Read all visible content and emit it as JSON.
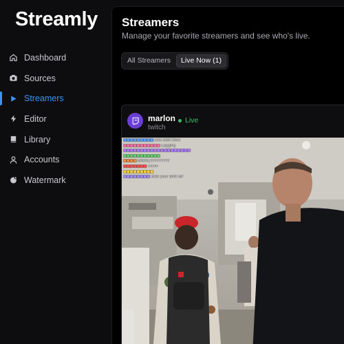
{
  "app": {
    "title": "Streamly"
  },
  "sidebar": {
    "items": [
      {
        "label": "Dashboard",
        "icon": "home-icon",
        "active": false
      },
      {
        "label": "Sources",
        "icon": "camera-icon",
        "active": false
      },
      {
        "label": "Streamers",
        "icon": "play-icon",
        "active": true
      },
      {
        "label": "Editor",
        "icon": "bolt-icon",
        "active": false
      },
      {
        "label": "Library",
        "icon": "book-icon",
        "active": false
      },
      {
        "label": "Accounts",
        "icon": "user-icon",
        "active": false
      },
      {
        "label": "Watermark",
        "icon": "watermark-icon",
        "active": false
      }
    ]
  },
  "page": {
    "title": "Streamers",
    "subtitle": "Manage your favorite streamers and see who's live."
  },
  "filters": {
    "all_label": "All Streamers",
    "live_label": "Live Now (1)",
    "selected": "Live Now (1)"
  },
  "stream_card": {
    "name": "marlon",
    "platform": "twitch",
    "status": "Live",
    "chat": [
      {
        "user": "",
        "message": "new shirt time",
        "color": "#5aa0ff"
      },
      {
        "user": "",
        "message": "Lagging",
        "color": "#ff6fa8"
      },
      {
        "user": "",
        "message": "",
        "color": "#b07cff"
      },
      {
        "user": "",
        "message": "",
        "color": "#62d36c"
      },
      {
        "user": "",
        "message": "BRRRZYYYYYYYYY",
        "color": "#ff8a3d"
      },
      {
        "user": "",
        "message": "FFFFF",
        "color": "#ff4d4d"
      },
      {
        "user": "",
        "message": "",
        "color": "#ffd23d"
      },
      {
        "user": "",
        "message": "take your shirt off",
        "color": "#9f8cff"
      }
    ]
  },
  "colors": {
    "accent": "#3b93f5",
    "live": "#3fbf6a",
    "twitch": "#6b3fd6"
  }
}
